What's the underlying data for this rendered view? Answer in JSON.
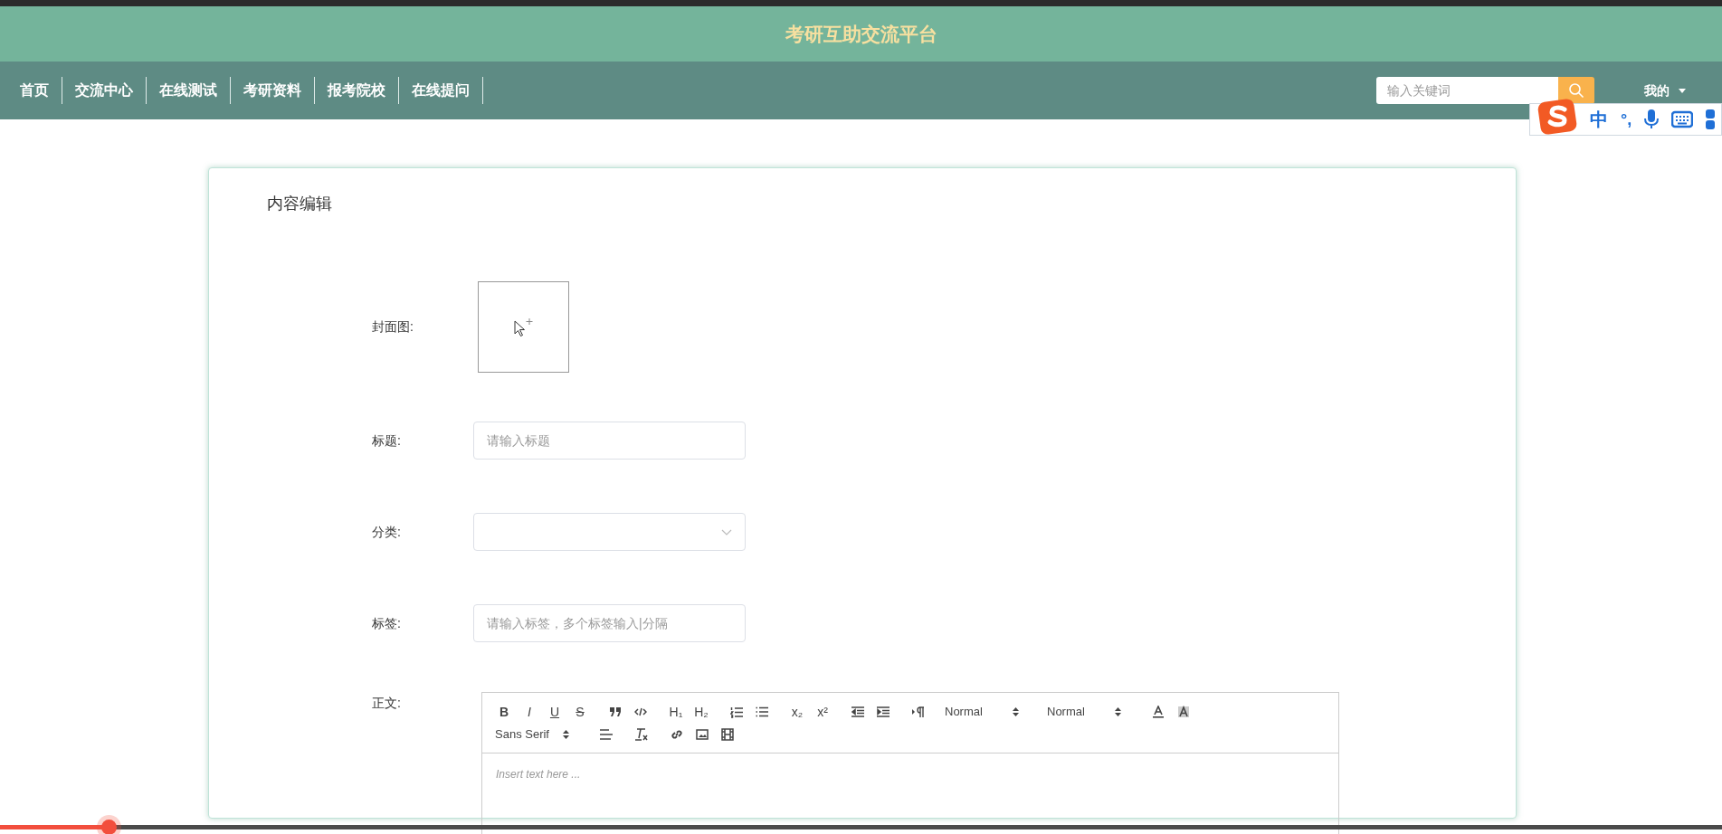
{
  "site_title": "考研互助交流平台",
  "nav": {
    "items": [
      "首页",
      "交流中心",
      "在线测试",
      "考研资料",
      "报考院校",
      "在线提问"
    ],
    "search": {
      "placeholder": "输入关键词"
    },
    "user_menu": "我的"
  },
  "ime_bar": {
    "mode": "中",
    "punctuation": "°,"
  },
  "editor_card": {
    "title": "内容编辑",
    "fields": [
      {
        "kind": "upload",
        "label": "封面图:"
      },
      {
        "kind": "text",
        "label": "标题:",
        "placeholder": "请输入标题"
      },
      {
        "kind": "select",
        "label": "分类:"
      },
      {
        "kind": "text",
        "label": "标签:",
        "placeholder": "请输入标签，多个标签输入|分隔"
      },
      {
        "kind": "editor",
        "label": "正文:"
      }
    ],
    "toolbar_rows": [
      [
        [
          {
            "kind": "bold",
            "text": "B"
          },
          {
            "kind": "italic",
            "text": "I"
          },
          {
            "kind": "underline",
            "text": "U"
          },
          {
            "kind": "strike",
            "text": "S"
          }
        ],
        [
          {
            "kind": "quote"
          },
          {
            "kind": "code"
          }
        ],
        [
          {
            "kind": "header",
            "text": "H₁"
          },
          {
            "kind": "header",
            "text": "H₂"
          }
        ],
        [
          {
            "kind": "ordered-list"
          },
          {
            "kind": "bullet-list"
          }
        ],
        [
          {
            "kind": "script",
            "text": "x₂"
          },
          {
            "kind": "script",
            "text": "x²"
          }
        ],
        [
          {
            "kind": "outdent"
          },
          {
            "kind": "indent"
          }
        ],
        [
          {
            "kind": "direction"
          }
        ],
        [
          {
            "kind": "picker",
            "text": "Normal"
          }
        ],
        [
          {
            "kind": "picker",
            "text": "Normal"
          }
        ],
        [
          {
            "kind": "color"
          },
          {
            "kind": "background"
          }
        ]
      ],
      [
        [
          {
            "kind": "picker",
            "text": "Sans Serif"
          }
        ],
        [
          {
            "kind": "align"
          }
        ],
        [
          {
            "kind": "clean"
          }
        ],
        [
          {
            "kind": "link"
          },
          {
            "kind": "image"
          },
          {
            "kind": "video"
          }
        ]
      ]
    ],
    "body_placeholder": "Insert text here ..."
  },
  "video_progress": {
    "level": 0.063
  }
}
